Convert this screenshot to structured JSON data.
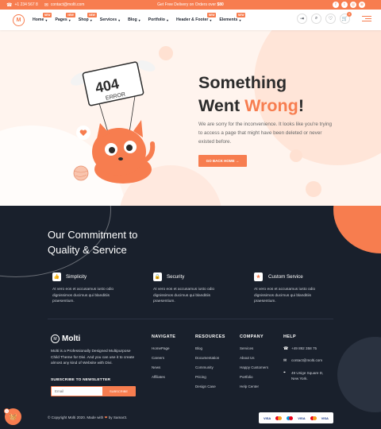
{
  "topbar": {
    "phone": "+1 234 567 8",
    "email": "contact@molti.com",
    "promo_prefix": "Get Free Delivery on Orders over ",
    "promo_amount": "$80",
    "social_icons": [
      "facebook-icon",
      "twitter-icon",
      "instagram-icon",
      "dribbble-icon"
    ]
  },
  "nav": {
    "logo_letter": "M",
    "menu": [
      {
        "label": "Home",
        "badge": "NEW"
      },
      {
        "label": "Pages",
        "badge": "NEW"
      },
      {
        "label": "Shop",
        "badge": "NEW"
      },
      {
        "label": "Services",
        "badge": ""
      },
      {
        "label": "Blog",
        "badge": ""
      },
      {
        "label": "Portfolio",
        "badge": ""
      },
      {
        "label": "Header & Footer",
        "badge": "NEW"
      },
      {
        "label": "Elements",
        "badge": "NEW"
      }
    ],
    "cart_count": "0"
  },
  "hero": {
    "title_line1": "Something",
    "title_line2_a": "Went ",
    "title_line2_b": "Wrong",
    "title_line2_c": "!",
    "text": "We are sorry for the inconvenience. It looks like you're trying to access a page that might have been deleted or never existed before.",
    "button": "GO BACK HOME →",
    "sign_code": "404",
    "sign_label": "ERROR"
  },
  "commitment": {
    "title_line1": "Our Commitment to",
    "title_line2": "Quality & Service",
    "features": [
      {
        "title": "Simplicity",
        "text": "At vero eos et accusamus iusto odio dignissimos ducimus qui blanditiis praesentium."
      },
      {
        "title": "Security",
        "text": "At vero eos et accusamus iusto odio dignissimos ducimus qui blanditiis praesentium."
      },
      {
        "title": "Custom Service",
        "text": "At vero eos et accusamus iusto odio dignissimos ducimus qui blanditiis praesentium."
      }
    ]
  },
  "footer": {
    "logo_text": "Molti",
    "description": "Molti is a Professionally Designed Multipurpose Child Theme for Divi. And you can use it to create almost any kind of Website with Divi.",
    "subscribe_heading": "SUBSCRIBE TO NEWSLETTER",
    "email_placeholder": "Email",
    "subscribe_button": "SUBSCRIBE",
    "columns": [
      {
        "heading": "NAVIGATE",
        "links": [
          "HomePage",
          "Careers",
          "News",
          "Affiliates"
        ]
      },
      {
        "heading": "RESOURCES",
        "links": [
          "Blog",
          "Documentation",
          "Community",
          "Pricing",
          "Design Case"
        ]
      },
      {
        "heading": "COMPANY",
        "links": [
          "Services",
          "About Us",
          "Happy Customers",
          "Portfolio",
          "Help Center"
        ]
      }
    ],
    "help_heading": "HELP",
    "help_phone": "+49 892 358 75",
    "help_email": "contact@molti.com",
    "help_address": "49 Unige Square D, New York.",
    "copyright_prefix": "© Copyright Molti 2020. Made with ",
    "copyright_suffix": " by Samar3.",
    "payment_cards": [
      "VISA",
      "MasterCard",
      "Maestro",
      "VISA",
      "MasterCard",
      "VISA"
    ],
    "floating_cart_count": "0"
  },
  "colors": {
    "accent": "#f77d4f",
    "dark": "#19202c",
    "hero_bg": "#fff4ee"
  }
}
